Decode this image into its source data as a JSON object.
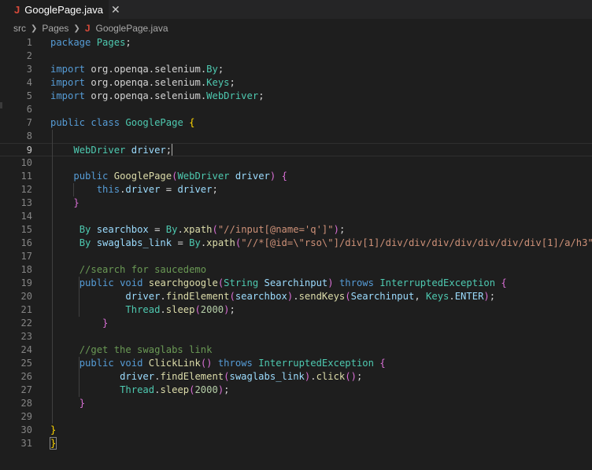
{
  "tab": {
    "icon": "J",
    "filename": "GooglePage.java",
    "close": "✕"
  },
  "breadcrumb": {
    "segments": [
      "src",
      "Pages"
    ],
    "file_icon": "J",
    "file": "GooglePage.java"
  },
  "editor": {
    "active_line": 9,
    "lines": [
      "package Pages;",
      "",
      "import org.openqa.selenium.By;",
      "import org.openqa.selenium.Keys;",
      "import org.openqa.selenium.WebDriver;",
      "",
      "public class GooglePage {",
      "",
      "    WebDriver driver;",
      "",
      "    public GooglePage(WebDriver driver) {",
      "        this.driver = driver;",
      "    }",
      "",
      "     By searchbox = By.xpath(\"//input[@name='q']\");",
      "     By swaglabs_link = By.xpath(\"//*[@id=\\\"rso\\\"]/div[1]/div/div/div/div/div/div/div[1]/a/h3\");",
      "",
      "     //search for saucedemo",
      "     public void searchgoogle(String Searchinput) throws InterruptedException {",
      "             driver.findElement(searchbox).sendKeys(Searchinput, Keys.ENTER);",
      "             Thread.sleep(2000);",
      "         }",
      "",
      "     //get the swaglabs link",
      "     public void ClickLink() throws InterruptedException {",
      "            driver.findElement(swaglabs_link).click();",
      "            Thread.sleep(2000);",
      "     }",
      "",
      "}",
      "}"
    ]
  },
  "colors": {
    "keyword": "#569cd6",
    "type": "#4ec9b0",
    "function": "#dcdcaa",
    "variable": "#9cdcfe",
    "string": "#ce9178",
    "comment": "#6a9955",
    "bracket_gold": "#ffd700",
    "bracket_purple": "#da70d6",
    "java_icon": "#d84a3a"
  }
}
